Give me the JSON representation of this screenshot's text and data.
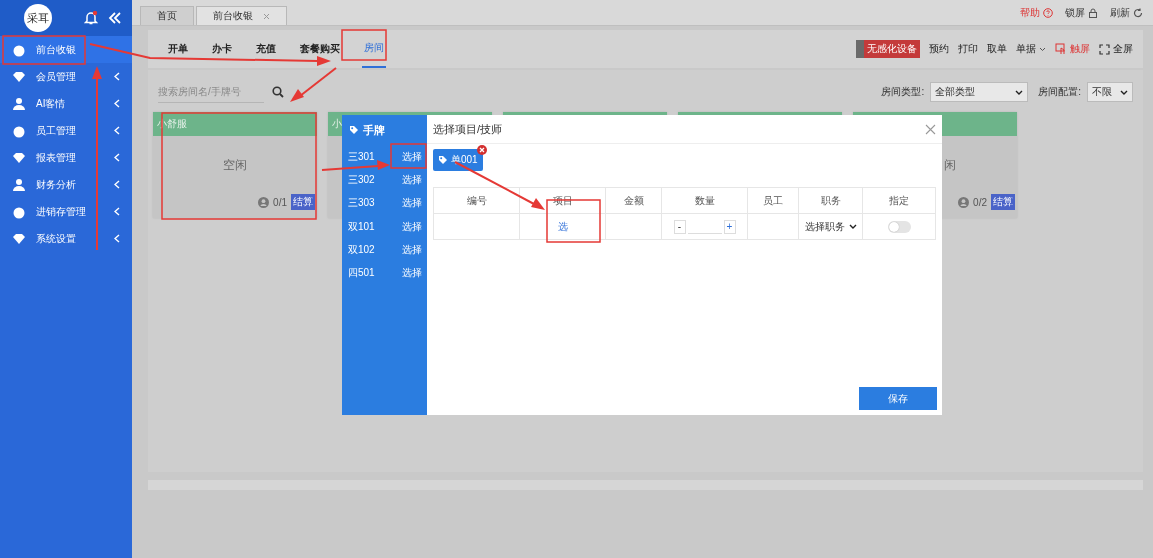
{
  "sidebar": {
    "logo": "采耳",
    "items": [
      {
        "label": "前台收银",
        "selected": true,
        "has_submenu": false
      },
      {
        "label": "会员管理",
        "selected": false,
        "has_submenu": true
      },
      {
        "label": "AI客情",
        "selected": false,
        "has_submenu": true
      },
      {
        "label": "员工管理",
        "selected": false,
        "has_submenu": true
      },
      {
        "label": "报表管理",
        "selected": false,
        "has_submenu": true
      },
      {
        "label": "财务分析",
        "selected": false,
        "has_submenu": true
      },
      {
        "label": "进销存管理",
        "selected": false,
        "has_submenu": true
      },
      {
        "label": "系统设置",
        "selected": false,
        "has_submenu": true
      }
    ]
  },
  "tabs": [
    {
      "label": "首页",
      "selected": false,
      "closable": false
    },
    {
      "label": "前台收银",
      "selected": true,
      "closable": true
    }
  ],
  "top_links": [
    {
      "label": "帮助",
      "kind": "help"
    },
    {
      "label": "锁屏",
      "kind": "lock"
    },
    {
      "label": "刷新",
      "kind": "refresh"
    }
  ],
  "nav_tabs": [
    {
      "label": "开单",
      "selected": false
    },
    {
      "label": "办卡",
      "selected": false
    },
    {
      "label": "充值",
      "selected": false
    },
    {
      "label": "套餐购买",
      "selected": false
    },
    {
      "label": "房间",
      "selected": true
    }
  ],
  "toolbar": {
    "device_badge": "无感化设备",
    "actions": [
      {
        "label": "预约",
        "kind": "plain"
      },
      {
        "label": "打印",
        "kind": "plain"
      },
      {
        "label": "取单",
        "kind": "plain"
      },
      {
        "label": "单据",
        "kind": "dropdown"
      },
      {
        "label": "触屏",
        "kind": "touch"
      },
      {
        "label": "全屏",
        "kind": "fullscreen"
      }
    ]
  },
  "search": {
    "placeholder": "搜索房间名/手牌号"
  },
  "filters": [
    {
      "label": "房间类型:",
      "value": "全部类型"
    },
    {
      "label": "房间配置:",
      "value": "不限"
    }
  ],
  "rooms": [
    {
      "kind": "room",
      "name": "小舒服",
      "status": "空闲",
      "count": "0/1",
      "action": "结算"
    },
    {
      "kind": "room",
      "name": "小"
    },
    {
      "kind": "room"
    },
    {
      "kind": "room"
    },
    {
      "kind": "room",
      "status": "闲",
      "count": "0/2",
      "action": "结算"
    }
  ],
  "hand_cards": {
    "title": "手牌",
    "items": [
      {
        "label": "三301",
        "action": "选择"
      },
      {
        "label": "三302",
        "action": "选择"
      },
      {
        "label": "三303",
        "action": "选择"
      },
      {
        "label": "双101",
        "action": "选择"
      },
      {
        "label": "双102",
        "action": "选择"
      },
      {
        "label": "四501",
        "action": "选择"
      }
    ]
  },
  "dialog": {
    "title": "选择项目/技师",
    "orders": [
      {
        "label": "单001",
        "removable": true
      }
    ],
    "columns": [
      "编号",
      "项目",
      "金额",
      "数量",
      "员工",
      "职务",
      "指定"
    ],
    "rows": [
      {
        "project": "选",
        "minus": "-",
        "plus": "+",
        "role_placeholder": "选择职务",
        "designated": false
      }
    ],
    "save": "保存"
  }
}
